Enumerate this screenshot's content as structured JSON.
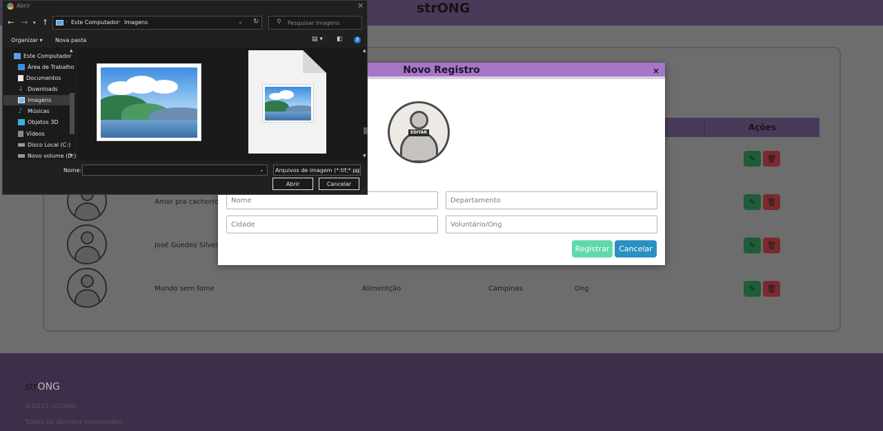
{
  "page": {
    "brand": "strONG",
    "table": {
      "col_acoes": "Ações"
    },
    "rows": [
      {
        "name": "Amor pra cachorro",
        "area": "",
        "city": "",
        "type": ""
      },
      {
        "name": "José Guedes Silveira",
        "area": "",
        "city": "",
        "type": ""
      },
      {
        "name": "Mundo sem fome",
        "area": "Alimentção",
        "city": "Campinas",
        "type": "Ong"
      }
    ],
    "footer": {
      "brand_a": "str",
      "brand_b": "ONG",
      "copyright": "©2021 strONG",
      "rights": "Todos os direitos reservados."
    }
  },
  "modal": {
    "title": "Novo Registro",
    "close": "×",
    "edit_label": "EDITAR",
    "fields": {
      "nome": "Nome",
      "departamento": "Departamento",
      "cidade": "Cidade",
      "voluntario": "Voluntário/Ong"
    },
    "register_label": "Registrar",
    "cancel_label": "Cancelar"
  },
  "dialog": {
    "title": "Abrir",
    "close": "✕",
    "breadcrumb": [
      "Este Computador",
      "Imagens"
    ],
    "search_placeholder": "Pesquisar Imagens",
    "toolbar": {
      "organize": "Organizar",
      "organize_arrow": "▾",
      "new_folder": "Nova pasta"
    },
    "tree": [
      {
        "label": "Este Computador",
        "icon": "computer-icon"
      },
      {
        "label": "Área de Trabalho",
        "icon": "desktop-icon"
      },
      {
        "label": "Documentos",
        "icon": "documents-icon"
      },
      {
        "label": "Downloads",
        "icon": "download-icon"
      },
      {
        "label": "Imagens",
        "icon": "pictures-icon",
        "selected": true
      },
      {
        "label": "Músicas",
        "icon": "music-icon"
      },
      {
        "label": "Objetos 3D",
        "icon": "objects-3d-icon"
      },
      {
        "label": "Vídeos",
        "icon": "videos-icon"
      },
      {
        "label": "Disco Local (C:)",
        "icon": "drive-icon"
      },
      {
        "label": "Novo volume (D:)",
        "icon": "drive-icon"
      }
    ],
    "filename_label": "Nome:",
    "filename_value": "",
    "filetype_value": "Arquivos de imagem (*.tif;*.pjp",
    "open_label": "Abrir",
    "cancel_label": "Cancelar"
  },
  "colors": {
    "accent_purple": "#a775c6",
    "register_green": "#5fd9a8",
    "cancel_blue": "#2a8fc2",
    "edit_green": "#28a745",
    "delete_red": "#dc3545"
  }
}
